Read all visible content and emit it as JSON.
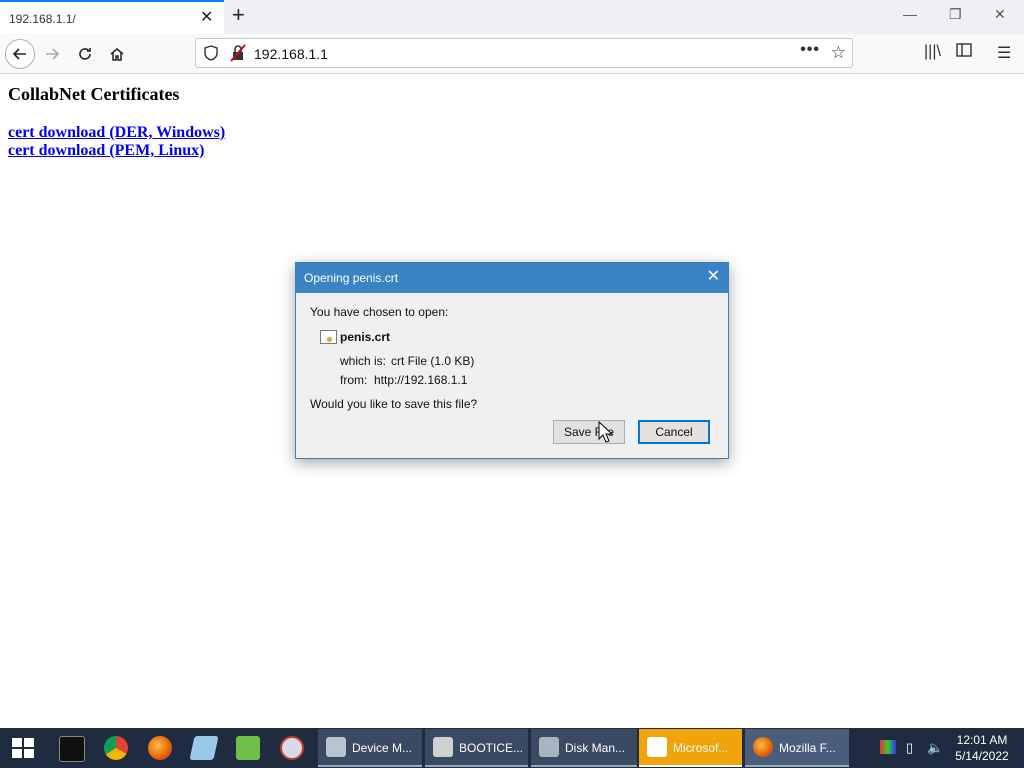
{
  "browser": {
    "tab_title": "192.168.1.1/",
    "url": "192.168.1.1"
  },
  "page": {
    "title": "CollabNet Certificates",
    "links": [
      "cert download (DER, Windows)",
      "cert download (PEM, Linux)"
    ]
  },
  "dialog": {
    "title": "Opening penis.crt",
    "prompt": "You have chosen to open:",
    "filename": "penis.crt",
    "which_is_label": "which is:",
    "which_is_value": "crt File (1.0 KB)",
    "from_label": "from:",
    "from_value": "http://192.168.1.1",
    "question": "Would you like to save this file?",
    "save_label": "Save File",
    "cancel_label": "Cancel"
  },
  "taskbar": {
    "apps": [
      {
        "label": "Device M..."
      },
      {
        "label": "BOOTICE..."
      },
      {
        "label": "Disk Man..."
      },
      {
        "label": "Microsof..."
      },
      {
        "label": "Mozilla F..."
      }
    ],
    "time": "12:01 AM",
    "date": "5/14/2022"
  },
  "colors": {
    "accent": "#0a84ff",
    "dialog_titlebar": "#3b84c4",
    "taskbar": "#1f2c3f",
    "link": "#0000ee"
  },
  "icons": [
    "close-icon",
    "plus-icon",
    "back-icon",
    "forward-icon",
    "reload-icon",
    "home-icon",
    "shield-icon",
    "insecure-lock-icon",
    "star-icon",
    "library-icon",
    "sidebar-icon",
    "menu-icon"
  ]
}
